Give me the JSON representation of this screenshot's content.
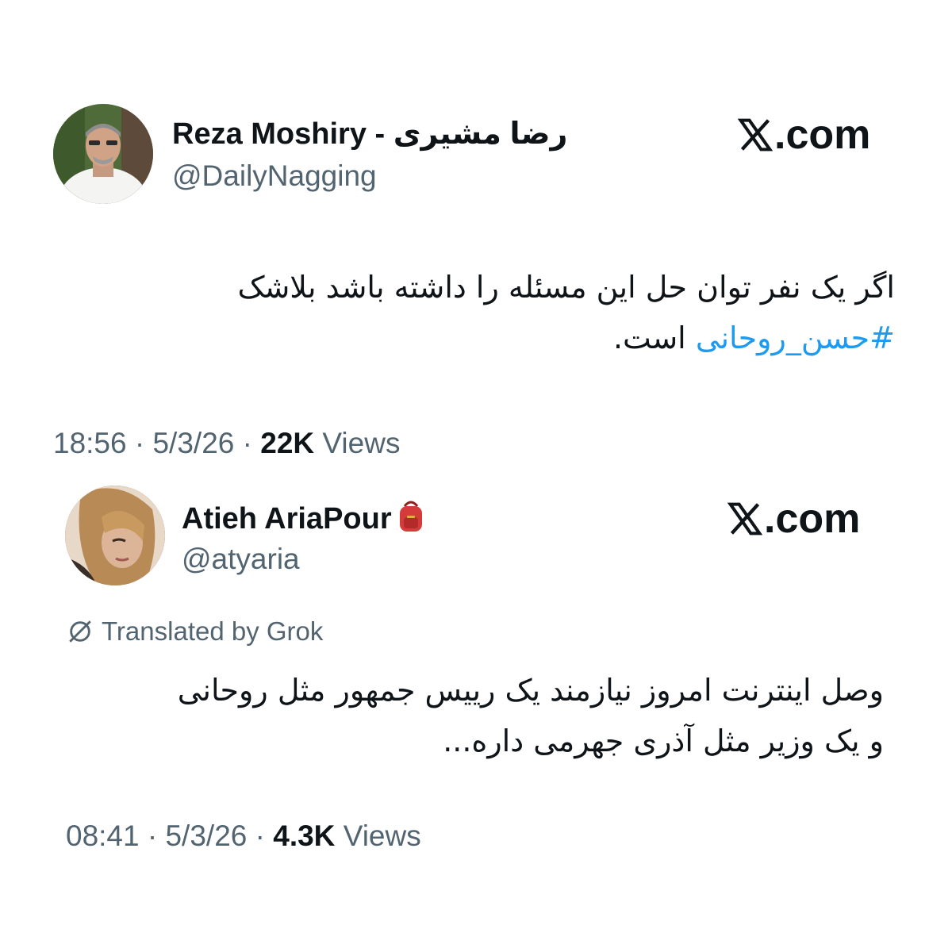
{
  "tweets": [
    {
      "display_name": "Reza Moshiry - رضا مشیری",
      "handle": "@DailyNagging",
      "source": ".com",
      "text_line1": "اگر یک نفر توان حل این مسئله را داشته باشد بلاشک",
      "hashtag": "#حسن_روحانی",
      "text_after_hashtag": " است.",
      "time": "18:56",
      "date": "5/3/26",
      "views_count": "22K",
      "views_label": "Views"
    },
    {
      "display_name": "Atieh AriaPour",
      "name_emoji": "backpack-emoji",
      "handle": "@atyaria",
      "source": ".com",
      "translated_label": "Translated by Grok",
      "text_line1": "وصل اینترنت امروز نیازمند یک رییس جمهور مثل روحانی",
      "text_line2": "و یک وزیر مثل آذری جهرمی داره...",
      "time": "08:41",
      "date": "5/3/26",
      "views_count": "4.3K",
      "views_label": "Views"
    }
  ],
  "separator": " · ",
  "colors": {
    "text": "#0f1419",
    "secondary": "#536471",
    "link": "#1d9bf0"
  }
}
